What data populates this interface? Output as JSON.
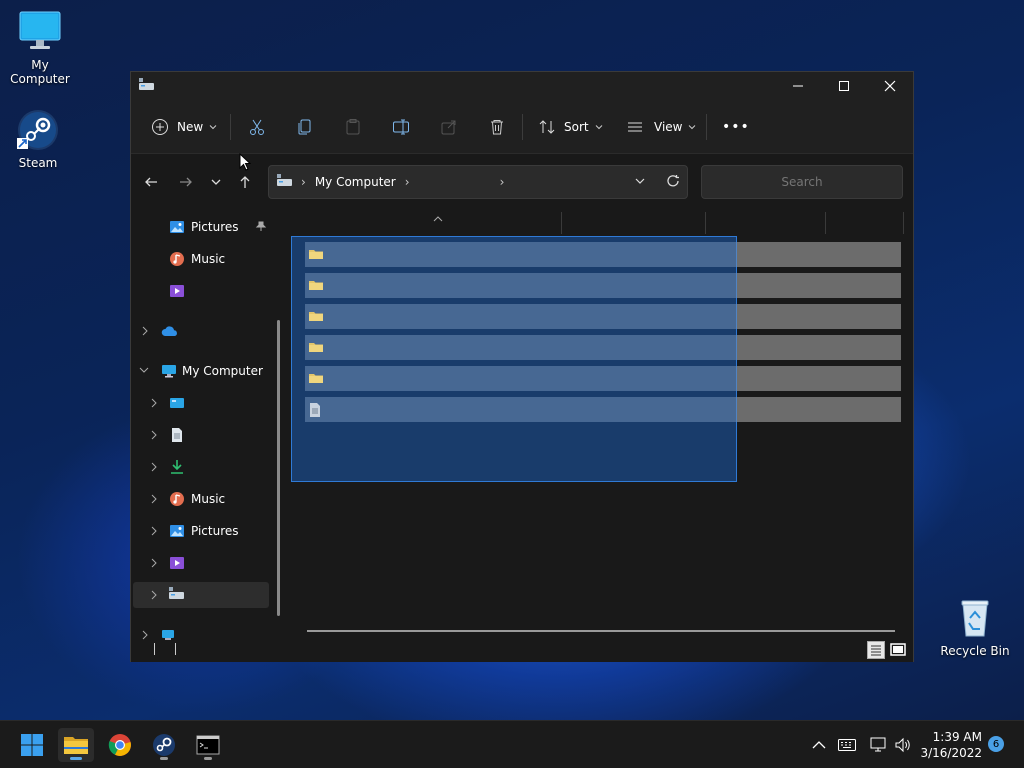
{
  "desktop": {
    "icons": [
      {
        "label": "My Computer"
      },
      {
        "label": "Steam"
      },
      {
        "label": "Recycle Bin"
      }
    ]
  },
  "explorer": {
    "toolbar": {
      "new_label": "New",
      "sort_label": "Sort",
      "view_label": "View",
      "more_label": "•••"
    },
    "address": {
      "crumb": "My Computer",
      "sep": "›"
    },
    "search": {
      "placeholder": "Search"
    },
    "nav_pane": {
      "pinned_pictures": "Pictures",
      "pinned_music": "Music",
      "this_pc": "My Computer",
      "music": "Music",
      "pictures": "Pictures"
    }
  },
  "taskbar": {
    "time": "1:39 AM",
    "date": "3/16/2022",
    "notifications": "6"
  },
  "colors": {
    "accent": "#0078d4",
    "selection": "#2f7ad6",
    "folder": "#e3c66b"
  }
}
